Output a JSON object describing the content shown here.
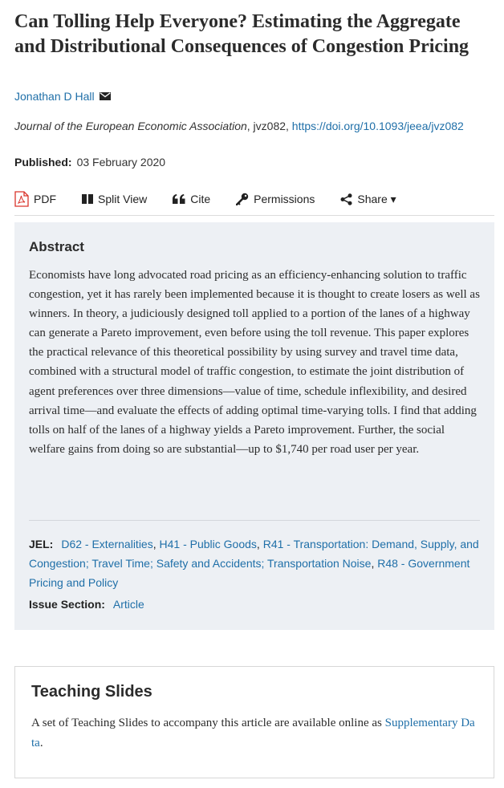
{
  "article": {
    "title": "Can Tolling Help Everyone? Estimating the Aggregate and Distributional Consequences of Congestion Pricing",
    "author": "Jonathan D Hall",
    "author_icon": "mail-icon",
    "journal": "Journal of the European Economic Association",
    "article_id": ", jvz082, ",
    "doi": "https://doi.org/10.1093/jeea/jvz082",
    "published_label": "Published:",
    "published_date": "03 February 2020"
  },
  "toolbar": {
    "pdf": "PDF",
    "split_view": "Split View",
    "cite": "Cite",
    "permissions": "Permissions",
    "share": "Share ▾"
  },
  "abstract": {
    "heading": "Abstract",
    "text": "Economists have long advocated road pricing as an efficiency-enhancing solution to traffic congestion, yet it has rarely been implemented because it is thought to create losers as well as winners. In theory, a judiciously designed toll applied to a portion of the lanes of a highway can generate a Pareto improvement, even before using the toll revenue. This paper explores the practical relevance of this theoretical possibility by using survey and travel time data, combined with a structural model of traffic congestion, to estimate the joint distribution of agent preferences over three dimensions—value of time, schedule inflexibility, and desired arrival time—and evaluate the effects of adding optimal time-varying tolls. I find that adding tolls on half of the lanes of a highway yields a Pareto improvement. Further, the social welfare gains from doing so are substantial—up to $1,740 per road user per year.",
    "jel_label": "JEL:",
    "jel_items": [
      "D62 - Externalities",
      "H41 - Public Goods",
      "R41 - Transportation: Demand, Supply, and Congestion; Travel Time; Safety and Accidents; Transportation Noise",
      "R48 - Government Pricing and Policy"
    ],
    "jel_separator": ", ",
    "issue_label": "Issue Section:",
    "issue_value": "Article"
  },
  "slides": {
    "heading": "Teaching Slides",
    "text": "A set of Teaching Slides to accompany this article are available online as ",
    "link": "Supplementary Data",
    "end": "."
  }
}
